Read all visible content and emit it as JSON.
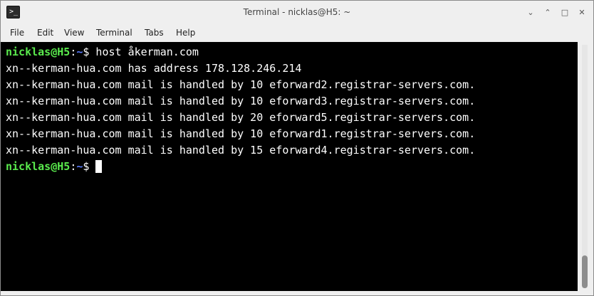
{
  "window": {
    "title": "Terminal - nicklas@H5: ~",
    "app_icon_glyph": ">_"
  },
  "window_controls": {
    "minimize": "⌄",
    "restore": "⌃",
    "maximize": "□",
    "close": "✕"
  },
  "menu": {
    "items": [
      "File",
      "Edit",
      "View",
      "Terminal",
      "Tabs",
      "Help"
    ]
  },
  "terminal": {
    "prompt_user": "nicklas@H5",
    "prompt_sep": ":",
    "prompt_path": "~",
    "prompt_symbol": "$",
    "command": " host åkerman.com",
    "output": [
      "xn--kerman-hua.com has address 178.128.246.214",
      "xn--kerman-hua.com mail is handled by 10 eforward2.registrar-servers.com.",
      "xn--kerman-hua.com mail is handled by 10 eforward3.registrar-servers.com.",
      "xn--kerman-hua.com mail is handled by 20 eforward5.registrar-servers.com.",
      "xn--kerman-hua.com mail is handled by 10 eforward1.registrar-servers.com.",
      "xn--kerman-hua.com mail is handled by 15 eforward4.registrar-servers.com."
    ],
    "colors": {
      "background": "#000000",
      "text": "#ffffff",
      "prompt_user": "#5aea4d",
      "prompt_path": "#5a7cff"
    }
  }
}
